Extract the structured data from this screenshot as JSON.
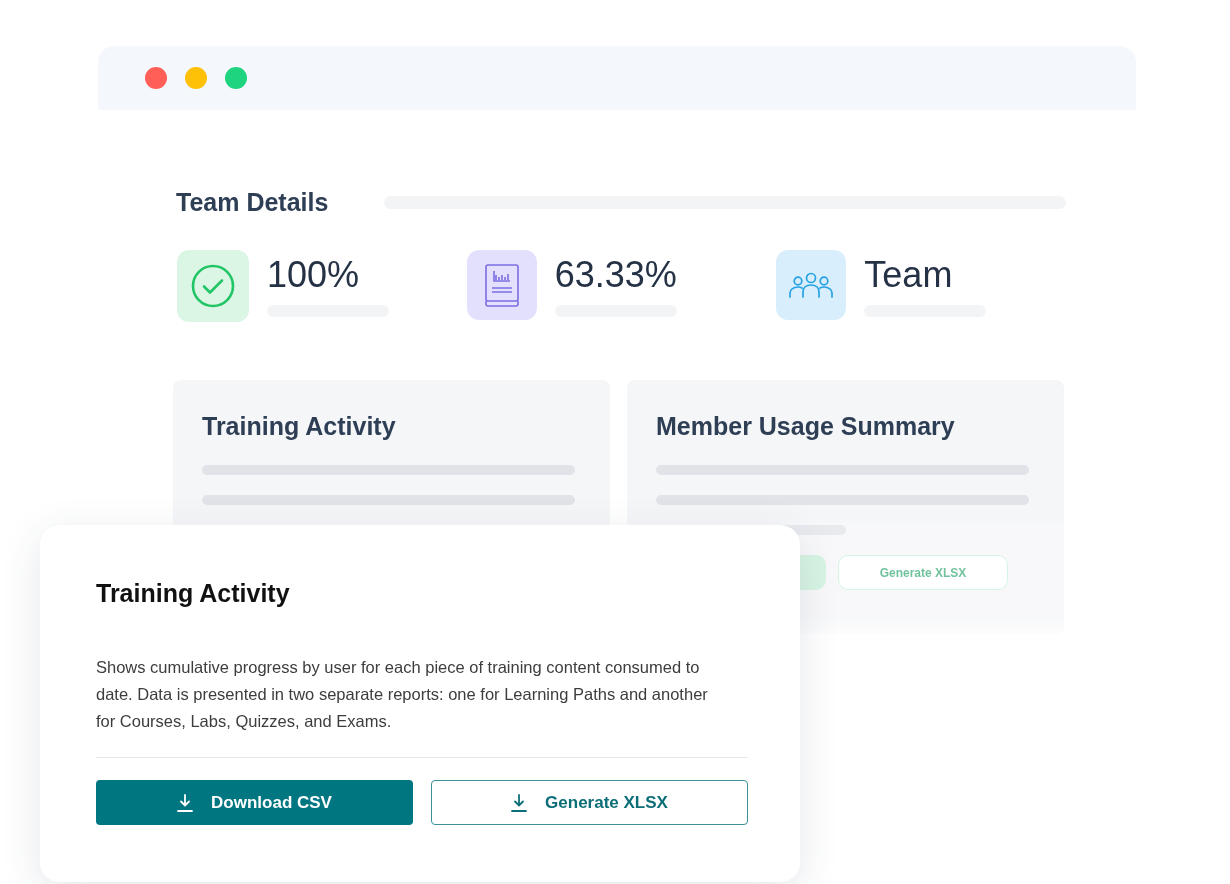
{
  "window": {
    "controls": [
      {
        "color": "#ff5f57"
      },
      {
        "color": "#ffc107"
      },
      {
        "color": "#1ed47e"
      }
    ]
  },
  "team_details": {
    "title": "Team Details",
    "stats": [
      {
        "kind": "check",
        "value": "100%"
      },
      {
        "kind": "book",
        "value": "63.33%"
      },
      {
        "kind": "team",
        "value": "Team"
      }
    ]
  },
  "panels": [
    {
      "title": "Training Activity"
    },
    {
      "title": "Member Usage Summary",
      "buttons": [
        "Generate XLSX"
      ]
    }
  ],
  "popup": {
    "title": "Training Activity",
    "description": "Shows cumulative progress by user for each piece of training content consumed to date. Data is presented in two separate reports: one for Learning Paths and another for Courses, Labs, Quizzes, and Exams.",
    "buttons": [
      {
        "kind": "primary",
        "label": "Download CSV"
      },
      {
        "kind": "secondary",
        "label": "Generate XLSX"
      }
    ]
  }
}
